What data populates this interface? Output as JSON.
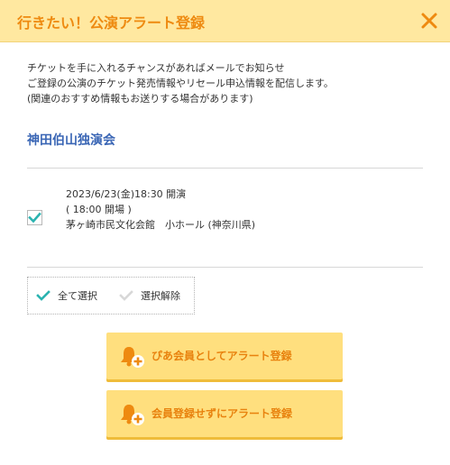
{
  "header": {
    "title": "行きたい！公演アラート登録"
  },
  "intro": {
    "lines": [
      "チケットを手に入れるチャンスがあればメールでお知らせ",
      "ご登録の公演のチケット発売情報やリセール申込情報を配信します。",
      "(関連のおすすめ情報もお送りする場合があります)"
    ]
  },
  "event": {
    "title": "神田伯山独演会"
  },
  "performance": {
    "datetime": "2023/6/23(金)18:30 開演",
    "open_time": "( 18:00 開場 )",
    "venue": "茅ヶ崎市民文化会館　小ホール (神奈川県)",
    "checked": true
  },
  "selection": {
    "select_all": "全て選択",
    "deselect_all": "選択解除"
  },
  "buttons": {
    "pia_member": "ぴあ会員としてアラート登録",
    "no_member": "会員登録せずにアラート登録"
  },
  "colors": {
    "accent": "#ee8a10",
    "header_bg": "#ffe8a0",
    "button_bg": "#ffdf7e",
    "link_blue": "#3a66b5",
    "check_teal": "#2bb3b0"
  }
}
